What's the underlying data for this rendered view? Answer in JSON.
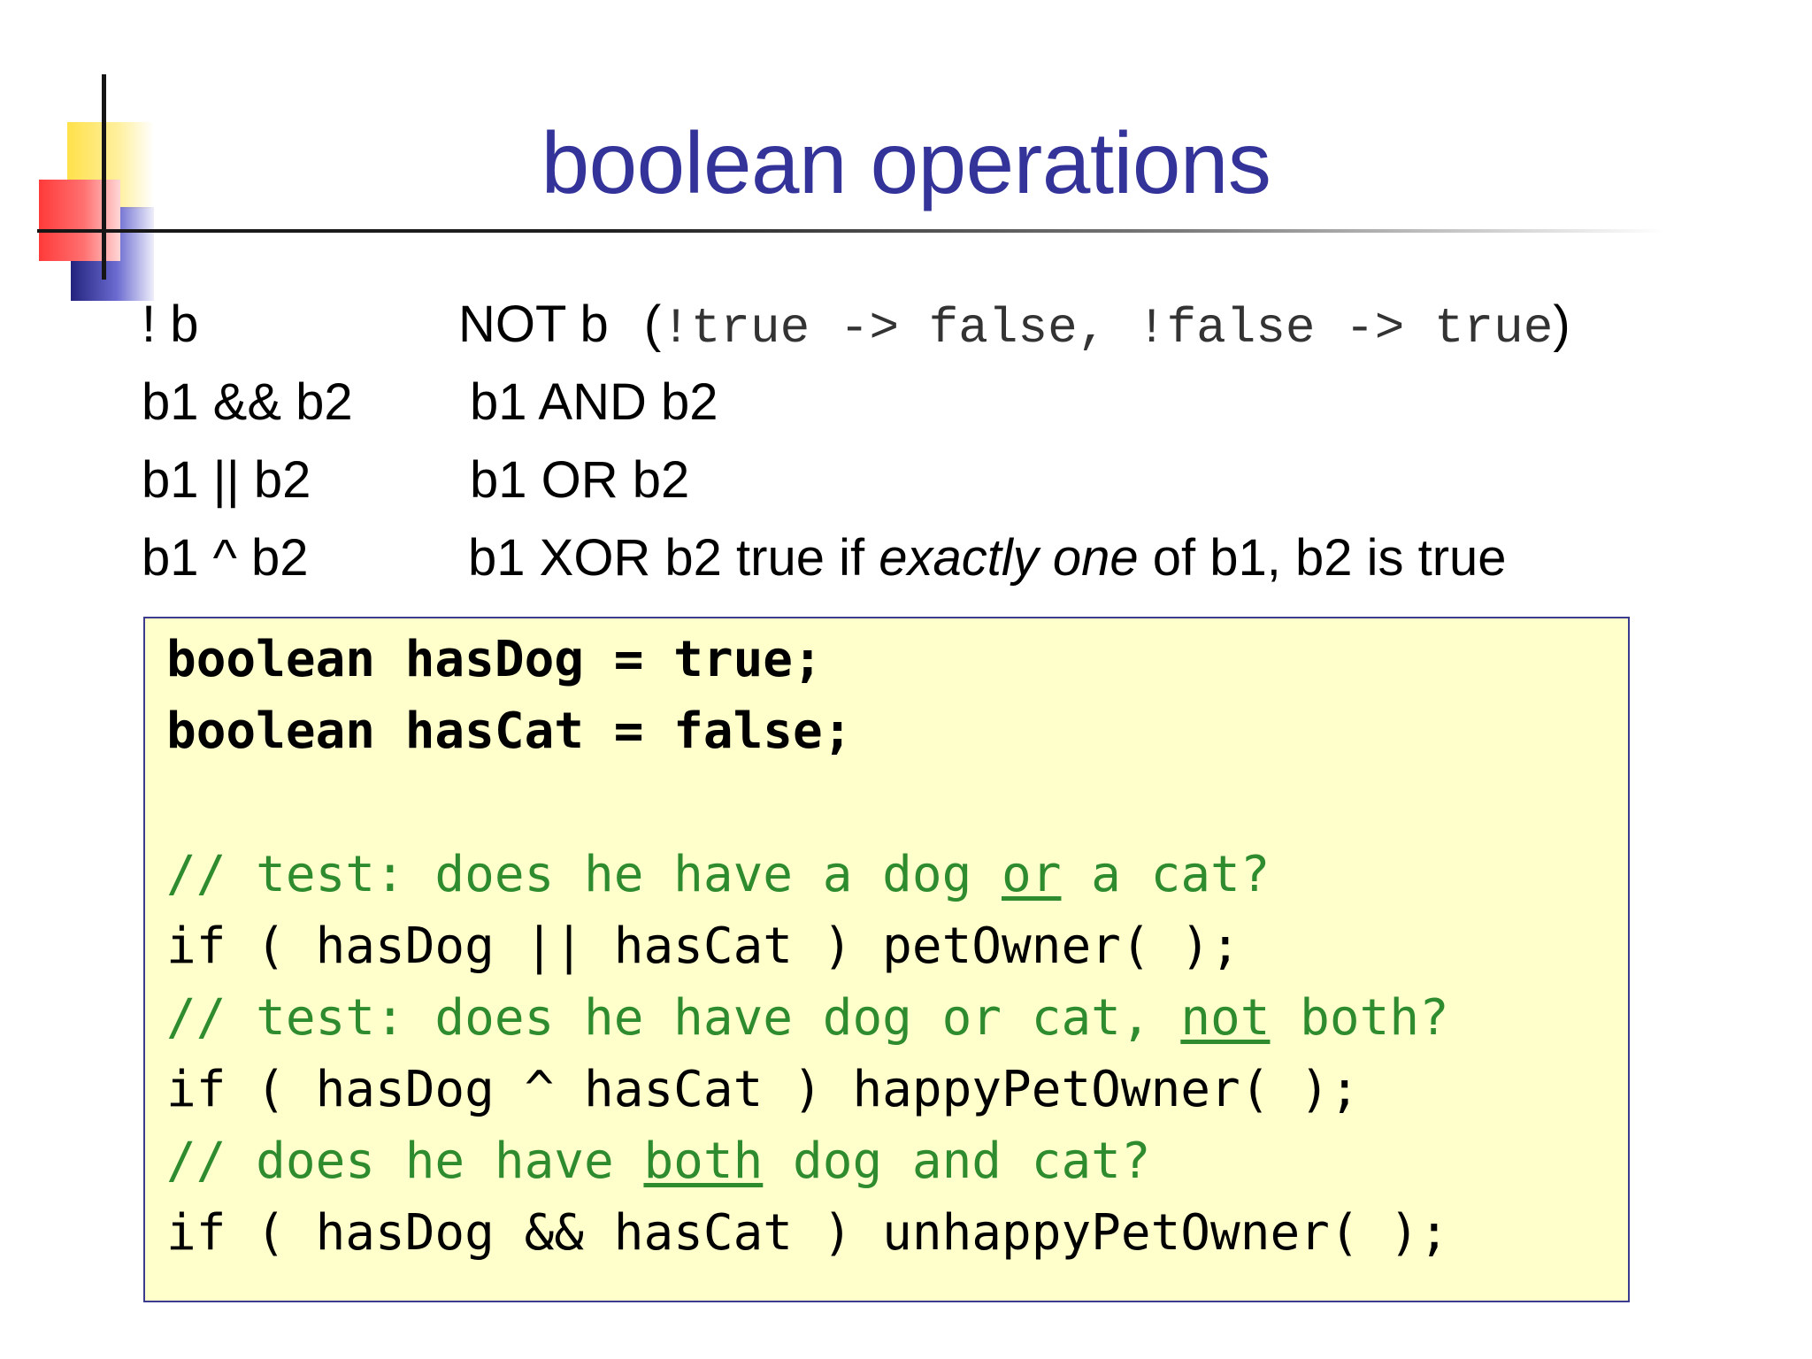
{
  "title": "boolean operations",
  "operators": [
    {
      "expr": "! b",
      "desc": "NOT b",
      "example_open": "(",
      "example_code": "!true -> false, !false -> true",
      "example_close": ")"
    },
    {
      "expr": "b1 && b2",
      "desc": "b1 AND b2"
    },
    {
      "expr": "b1 || b2",
      "desc": "b1 OR b2"
    },
    {
      "expr": "b1 ^ b2",
      "desc_pre": "b1 XOR b2 true if ",
      "desc_em": "exactly one",
      "desc_post": " of b1, b2 is true"
    }
  ],
  "code": {
    "decl1": "boolean hasDog = true;",
    "decl2": "boolean hasCat = false;",
    "c1_pre": "// test: does he have a dog ",
    "c1_u": "or",
    "c1_post": " a cat?",
    "s1": "if ( hasDog || hasCat ) petOwner( );",
    "c2_pre": "// test: does he have dog or cat, ",
    "c2_u": "not",
    "c2_post": " both?",
    "s2": "if ( hasDog ^ hasCat ) happyPetOwner( );",
    "c3_pre": "// does he have ",
    "c3_u": "both",
    "c3_post": " dog and cat?",
    "s3": "if ( hasDog && hasCat ) unhappyPetOwner( );"
  },
  "colors": {
    "title": "#333399",
    "comment": "#2e8b2e",
    "code_background": "#ffffcc"
  }
}
